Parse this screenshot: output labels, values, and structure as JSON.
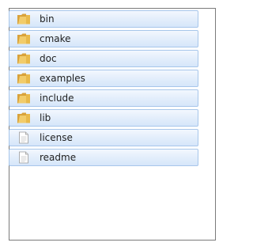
{
  "items": [
    {
      "label": "bin",
      "type": "folder",
      "icon": "folder-icon"
    },
    {
      "label": "cmake",
      "type": "folder",
      "icon": "folder-icon"
    },
    {
      "label": "doc",
      "type": "folder",
      "icon": "folder-icon"
    },
    {
      "label": "examples",
      "type": "folder",
      "icon": "folder-icon"
    },
    {
      "label": "include",
      "type": "folder",
      "icon": "folder-icon"
    },
    {
      "label": "lib",
      "type": "folder",
      "icon": "folder-icon"
    },
    {
      "label": "license",
      "type": "file",
      "icon": "file-icon"
    },
    {
      "label": "readme",
      "type": "file",
      "icon": "file-icon"
    }
  ],
  "colors": {
    "row_border": "#a7c6ea",
    "row_top": "#f3f8fe",
    "row_bottom": "#d6e6fa",
    "frame_border": "#7a7a7a",
    "folder": "#e8b94a"
  }
}
